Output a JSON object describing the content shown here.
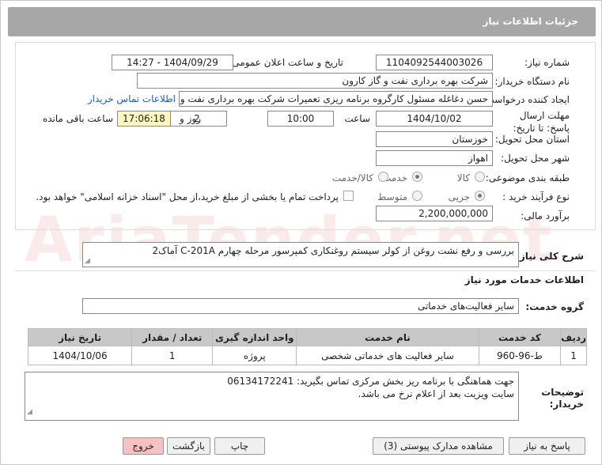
{
  "header": {
    "title": "جزئیات اطلاعات نیاز"
  },
  "form": {
    "need_number_label": "شماره نیاز:",
    "need_number": "1104092544003026",
    "announce_label": "تاریخ و ساعت اعلان عمومی:",
    "announce_value": "1404/09/29 - 14:27",
    "buyer_label": "نام دستگاه خریدار:",
    "buyer_value": "شرکت بهره برداری نفت و گاز کارون",
    "creator_label": "ایجاد کننده درخواست:",
    "creator_value": "حسن دغاغله مسئول کارگروه برنامه ریزی تعمیرات شرکت بهره برداری نفت و گاز",
    "contact_link": "اطلاعات تماس خریدار",
    "deadline_label": "مهلت ارسال پاسخ: تا تاریخ:",
    "deadline_date": "1404/10/02",
    "time_label": "ساعت",
    "deadline_time": "10:00",
    "days_value": "2",
    "days_label": "روز و",
    "remaining_time": "17:06:18",
    "remaining_label": "ساعت باقی مانده",
    "province_label": "استان محل تحویل:",
    "province_value": "خوزستان",
    "city_label": "شهر محل تحویل:",
    "city_value": "اهواز",
    "category_label": "طبقه بندی موضوعی:",
    "category_options": [
      "کالا",
      "خدمت",
      "کالا/خدمت"
    ],
    "category_selected": "خدمت",
    "purchase_label": "نوع فرآیند خرید :",
    "purchase_options": [
      "جزیی",
      "متوسط"
    ],
    "purchase_selected": "جزیی",
    "payment_note": "پرداخت تمام یا بخشی از مبلغ خرید،از محل \"اسناد خزانه اسلامی\" خواهد بود.",
    "estimate_label": "برآورد مالی:",
    "estimate_value": "2,200,000,000"
  },
  "summary": {
    "label": "شرح کلی نیاز:",
    "value": "بررسی و رفع نشت روغن از کولر سیستم روغنکاری کمپرسور مرحله چهارم C-201A آماک2"
  },
  "services": {
    "section_title": "اطلاعات خدمات مورد نیاز",
    "group_label": "گروه خدمت:",
    "group_value": "سایر فعالیت‌های خدماتی",
    "columns": [
      "ردیف",
      "کد خدمت",
      "نام خدمت",
      "واحد اندازه گیری",
      "تعداد / مقدار",
      "تاریخ نیاز"
    ],
    "rows": [
      [
        "1",
        "ط-96-960",
        "سایر فعالیت های خدماتی شخصی",
        "پروژه",
        "1",
        "1404/10/06"
      ]
    ]
  },
  "notes": {
    "label": "توضیحات خریدار:",
    "line1": "جهت هماهنگی با برنامه ریز بخش مرکزی تماس بگیرید: 06134172241",
    "line2": "سایت ویزیت بعد از اعلام نرخ می باشد."
  },
  "buttons": {
    "reply": "پاسخ به نیاز",
    "attachments": "مشاهده مدارک پیوستی (3)",
    "print": "چاپ",
    "back": "بازگشت",
    "exit": "خروج"
  },
  "colors": {
    "titlebar": "#a7a7a7",
    "link": "#1a5fb4",
    "remaining_bg": "#fff6c0",
    "exit_button": "#f6c1c1"
  }
}
